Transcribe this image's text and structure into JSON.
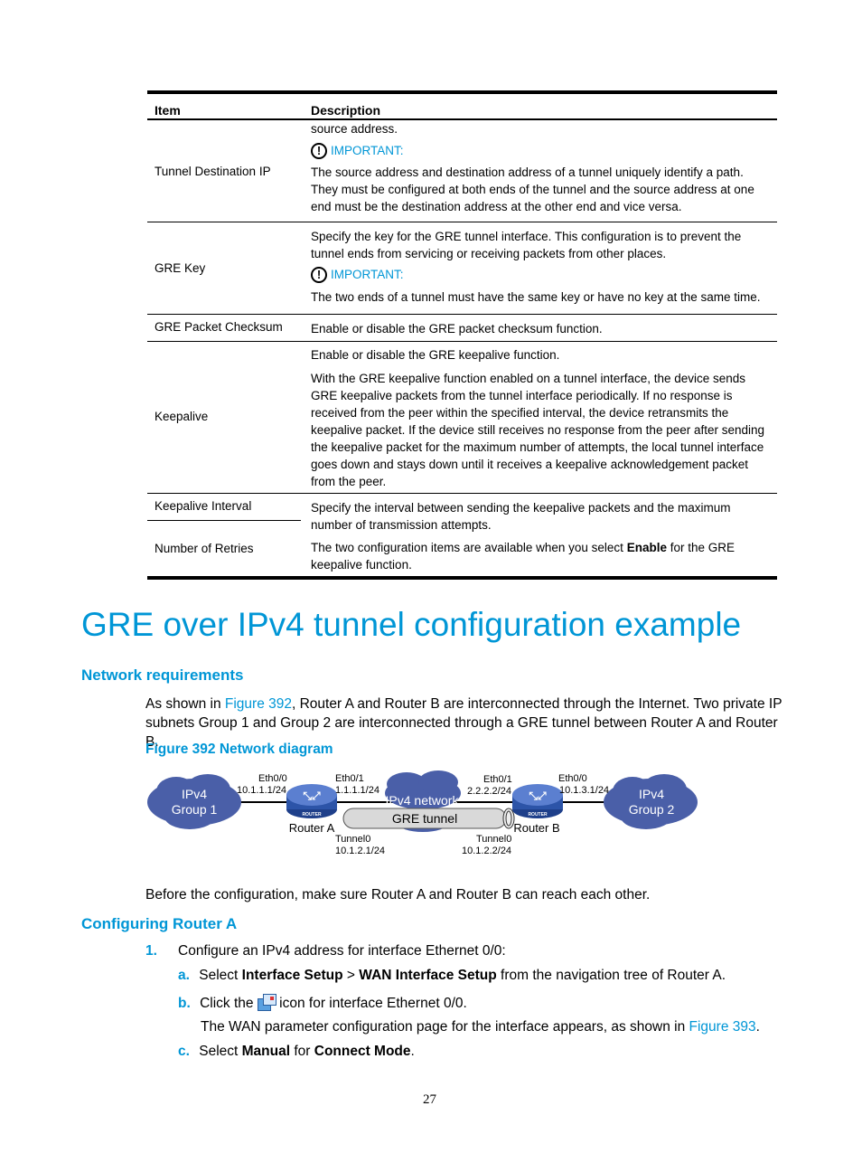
{
  "table": {
    "headers": {
      "item": "Item",
      "description": "Description"
    },
    "rows": [
      {
        "item": "Tunnel Destination IP",
        "desc_lines": [
          "source address."
        ],
        "important_label": "IMPORTANT:",
        "important_text": "The source address and destination address of a tunnel uniquely identify a path. They must be configured at both ends of the tunnel and the source address at one end must be the destination address at the other end and vice versa."
      },
      {
        "item": "GRE Key",
        "desc": "Specify the key for the GRE tunnel interface. This configuration is to prevent the tunnel ends from servicing or receiving packets from other places.",
        "important_label": "IMPORTANT:",
        "important_text": "The two ends of a tunnel must have the same key or have no key at the same time."
      },
      {
        "item": "GRE Packet Checksum",
        "desc": "Enable or disable the GRE packet checksum function."
      },
      {
        "item": "Keepalive",
        "desc": "Enable or disable the GRE keepalive function.",
        "desc2": "With the GRE keepalive function enabled on a tunnel interface, the device sends GRE keepalive packets from the tunnel interface periodically. If no response is received from the peer within the specified interval, the device retransmits the keepalive packet. If the device still receives no response from the peer after sending the keepalive packet for the maximum number of attempts, the local tunnel interface goes down and stays down until it receives a keepalive acknowledgement packet from the peer."
      },
      {
        "item": "Keepalive Interval",
        "item2": "Number of Retries",
        "desc": "Specify the interval between sending the keepalive packets and the maximum number of transmission attempts.",
        "desc2_pre": "The two configuration items are available when you select ",
        "desc2_bold": "Enable",
        "desc2_post": " for the GRE keepalive function."
      }
    ]
  },
  "section_title": "GRE over IPv4 tunnel configuration example",
  "network_requirements": {
    "heading": "Network requirements",
    "para_pre": "As shown in ",
    "para_link": "Figure 392",
    "para_post": ", Router A and Router B are interconnected through the Internet. Two private IP subnets Group 1 and Group 2 are interconnected through a GRE tunnel between Router A and Router B.",
    "figure_caption": "Figure 392 Network diagram"
  },
  "diagram": {
    "group1": [
      "IPv4",
      "Group 1"
    ],
    "group2": [
      "IPv4",
      "Group 2"
    ],
    "router_a": "Router A",
    "router_b": "Router B",
    "router_badge": "ROUTER",
    "network": "IPv4 network",
    "tunnel": "GRE tunnel",
    "a_eth00": [
      "Eth0/0",
      "10.1.1.1/24"
    ],
    "a_eth01": [
      "Eth0/1",
      "1.1.1.1/24"
    ],
    "a_tunnel": [
      "Tunnel0",
      "10.1.2.1/24"
    ],
    "b_eth01": [
      "Eth0/1",
      "2.2.2.2/24"
    ],
    "b_eth00": [
      "Eth0/0",
      "10.1.3.1/24"
    ],
    "b_tunnel": [
      "Tunnel0",
      "10.1.2.2/24"
    ]
  },
  "before_config": "Before the configuration, make sure Router A and Router B can reach each other.",
  "configuring": {
    "heading": "Configuring Router A",
    "step1_num": "1.",
    "step1": "Configure an IPv4 address for interface Ethernet 0/0:",
    "a_label": "a.",
    "a_pre": "Select ",
    "a_b1": "Interface Setup",
    "a_mid": " > ",
    "a_b2": "WAN Interface Setup",
    "a_post": " from the navigation tree of Router A.",
    "b_label": "b.",
    "b_pre": "Click the ",
    "b_post": " icon for interface Ethernet 0/0.",
    "b_note_pre": "The WAN parameter configuration page for the interface appears, as shown in ",
    "b_note_link": "Figure 393",
    "b_note_post": ".",
    "c_label": "c.",
    "c_pre": "Select ",
    "c_b1": "Manual",
    "c_mid": " for ",
    "c_b2": "Connect Mode",
    "c_post": "."
  },
  "page_number": "27"
}
